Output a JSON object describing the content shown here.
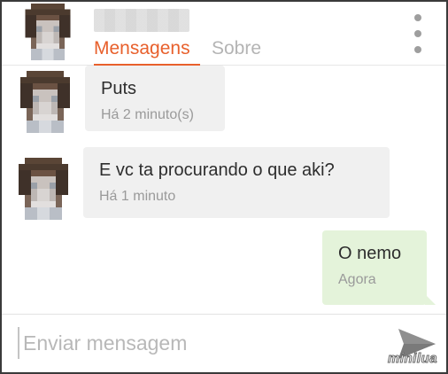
{
  "header": {
    "contact_name": "",
    "tabs": [
      {
        "label": "Mensagens",
        "active": true
      },
      {
        "label": "Sobre",
        "active": false
      }
    ],
    "menu_icon": "more-vertical-icon"
  },
  "messages": [
    {
      "direction": "incoming",
      "text": "Puts",
      "time": "Há 2 minuto(s)"
    },
    {
      "direction": "incoming",
      "text": "E vc ta procurando o que aki?",
      "time": "Há 1 minuto"
    },
    {
      "direction": "outgoing",
      "text": "O nemo",
      "time": "Agora"
    }
  ],
  "composer": {
    "placeholder": "Enviar mensagem",
    "value": "",
    "send_icon": "send-icon"
  },
  "watermark": "minilua",
  "colors": {
    "accent": "#e8602c",
    "incoming_bubble": "#f0f0f0",
    "outgoing_bubble": "#e4f3da",
    "inactive_tab": "#b4b4b4"
  }
}
